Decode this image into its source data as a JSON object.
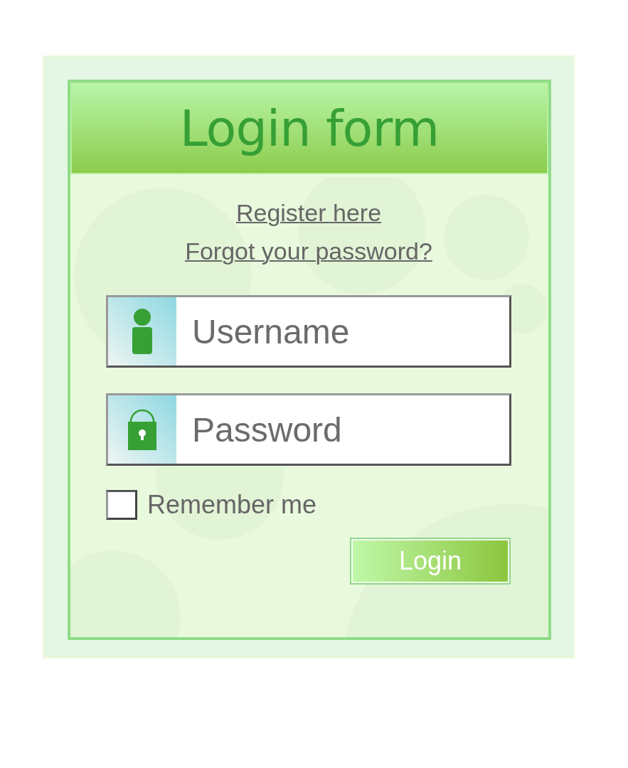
{
  "header": {
    "title": "Login form"
  },
  "links": [
    "Register here",
    "Forgot your password?"
  ],
  "fields": [
    {
      "kind": "user",
      "placeholder": "Username"
    },
    {
      "kind": "password",
      "placeholder": "Password"
    }
  ],
  "remember": {
    "label": "Remember me",
    "checked": false
  },
  "submit": {
    "label": "Login"
  }
}
